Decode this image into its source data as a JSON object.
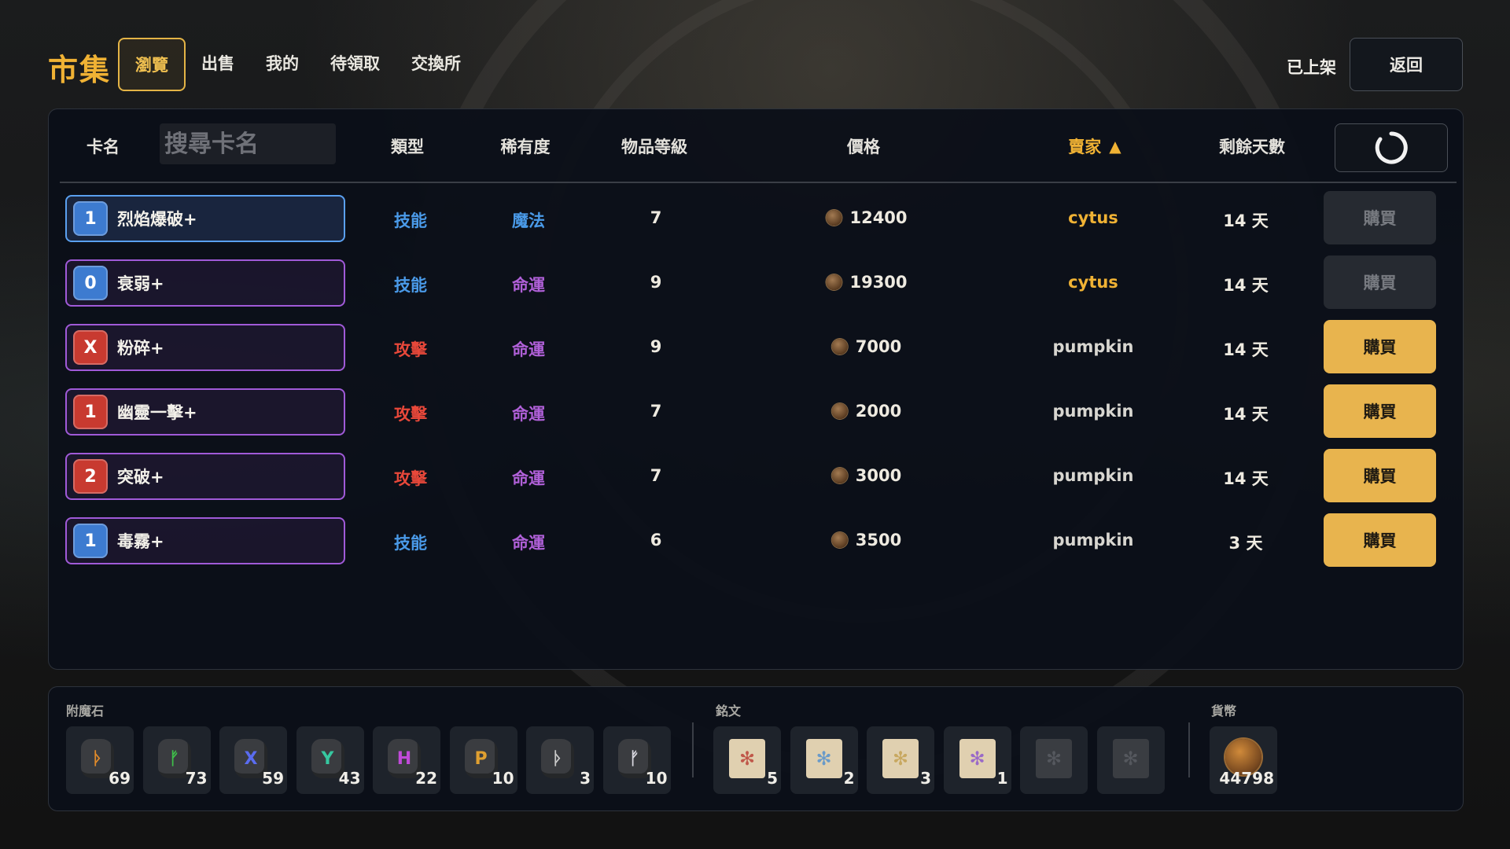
{
  "header": {
    "title": "市集",
    "tabs": [
      "瀏覽",
      "出售",
      "我的",
      "待領取",
      "交換所"
    ],
    "listed_label": "已上架",
    "back_label": "返回"
  },
  "table": {
    "columns": {
      "card_name": "卡名",
      "type": "類型",
      "rarity": "稀有度",
      "level": "物品等級",
      "price": "價格",
      "seller": "賣家",
      "days_left": "剩餘天數"
    },
    "search_placeholder": "搜尋卡名",
    "sort_indicator": "▲",
    "rows": [
      {
        "cost": "1",
        "cost_color": "blue",
        "name": "烈焰爆破+",
        "type": "技能",
        "rarity": "魔法",
        "level": "7",
        "price": "12400",
        "seller": "cytus",
        "days": "14 天",
        "buy": "購買",
        "buy_enabled": false
      },
      {
        "cost": "0",
        "cost_color": "blue",
        "name": "衰弱+",
        "type": "技能",
        "rarity": "命運",
        "level": "9",
        "price": "19300",
        "seller": "cytus",
        "days": "14 天",
        "buy": "購買",
        "buy_enabled": false
      },
      {
        "cost": "X",
        "cost_color": "red",
        "name": "粉碎+",
        "type": "攻擊",
        "rarity": "命運",
        "level": "9",
        "price": "7000",
        "seller": "pumpkin",
        "days": "14 天",
        "buy": "購買",
        "buy_enabled": true
      },
      {
        "cost": "1",
        "cost_color": "red",
        "name": "幽靈一擊+",
        "type": "攻擊",
        "rarity": "命運",
        "level": "7",
        "price": "2000",
        "seller": "pumpkin",
        "days": "14 天",
        "buy": "購買",
        "buy_enabled": true
      },
      {
        "cost": "2",
        "cost_color": "red",
        "name": "突破+",
        "type": "攻擊",
        "rarity": "命運",
        "level": "7",
        "price": "3000",
        "seller": "pumpkin",
        "days": "14 天",
        "buy": "購買",
        "buy_enabled": true
      },
      {
        "cost": "1",
        "cost_color": "blue",
        "name": "毒霧+",
        "type": "技能",
        "rarity": "命運",
        "level": "6",
        "price": "3500",
        "seller": "pumpkin",
        "days": "3 天",
        "buy": "購買",
        "buy_enabled": true
      }
    ]
  },
  "inventory": {
    "enchant_label": "附魔石",
    "inscription_label": "銘文",
    "currency_label": "貨幣",
    "enchant_stones": [
      {
        "icon": "rune-orange-icon",
        "glyph": "ᚦ",
        "color": "#e08a2a",
        "qty": "69"
      },
      {
        "icon": "rune-green-icon",
        "glyph": "ᚠ",
        "color": "#3fbf4a",
        "qty": "73"
      },
      {
        "icon": "rune-blue-icon",
        "glyph": "X",
        "color": "#5a6cf0",
        "qty": "59"
      },
      {
        "icon": "rune-teal-icon",
        "glyph": "Y",
        "color": "#36c8a0",
        "qty": "43"
      },
      {
        "icon": "rune-purple-icon",
        "glyph": "H",
        "color": "#c04ad8",
        "qty": "22"
      },
      {
        "icon": "rune-gold-icon",
        "glyph": "P",
        "color": "#e0a030",
        "qty": "10"
      },
      {
        "icon": "rune-gray-icon",
        "glyph": "ᚦ",
        "color": "#c8c8c8",
        "qty": "3"
      },
      {
        "icon": "rune-white-icon",
        "glyph": "ᚠ",
        "color": "#d8d8e0",
        "qty": "10"
      }
    ],
    "inscriptions": [
      {
        "icon": "inscription-red-icon",
        "color": "#c0584a",
        "qty": "5"
      },
      {
        "icon": "inscription-blue-icon",
        "color": "#6a9ac8",
        "qty": "2"
      },
      {
        "icon": "inscription-gold-icon",
        "color": "#c8a860",
        "qty": "3"
      },
      {
        "icon": "inscription-purple-icon",
        "color": "#9a6ac8",
        "qty": "1"
      },
      {
        "icon": "inscription-empty-icon",
        "color": "#3a3d42",
        "qty": ""
      },
      {
        "icon": "inscription-dark-icon",
        "color": "#3a3d42",
        "qty": ""
      }
    ],
    "currency": {
      "icon": "gold-coin-icon",
      "qty": "44798"
    }
  },
  "colors": {
    "accent": "#f0b234",
    "skill_type": "#4a9ae8",
    "attack_type": "#e8483a",
    "rarity_magic": "#4a9ae8",
    "rarity_destiny": "#b060d8",
    "seller_self": "#f0b234",
    "seller_other": "#d8d6d0",
    "cost_blue": "#3d7bd0",
    "cost_red": "#c83a30"
  }
}
